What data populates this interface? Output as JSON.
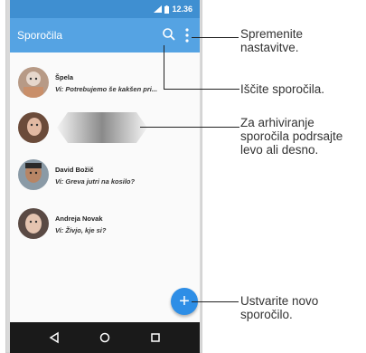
{
  "status": {
    "time": "12.36"
  },
  "appbar": {
    "title": "Sporočila"
  },
  "messages": [
    {
      "name": "Špela",
      "text": "Vi: Potrebujemo še kakšen pri..."
    },
    {
      "name": "",
      "text": ""
    },
    {
      "name": "David Božič",
      "text": "Vi: Greva jutri na kosilo?"
    },
    {
      "name": "Andreja Novak",
      "text": "Vi: Živjo, kje si?"
    }
  ],
  "fab": {
    "label": "+"
  },
  "callouts": {
    "settings": [
      "Spremenite",
      "nastavitve."
    ],
    "search": [
      "Iščite sporočila."
    ],
    "archive": [
      "Za arhiviranje",
      "sporočila podrsajte",
      "levo ali desno."
    ],
    "compose": [
      "Ustvarite novo",
      "sporočilo."
    ]
  },
  "colors": {
    "statusbar": "#3f8fd1",
    "appbar": "#55a3e3",
    "fab": "#2e8ee6"
  }
}
